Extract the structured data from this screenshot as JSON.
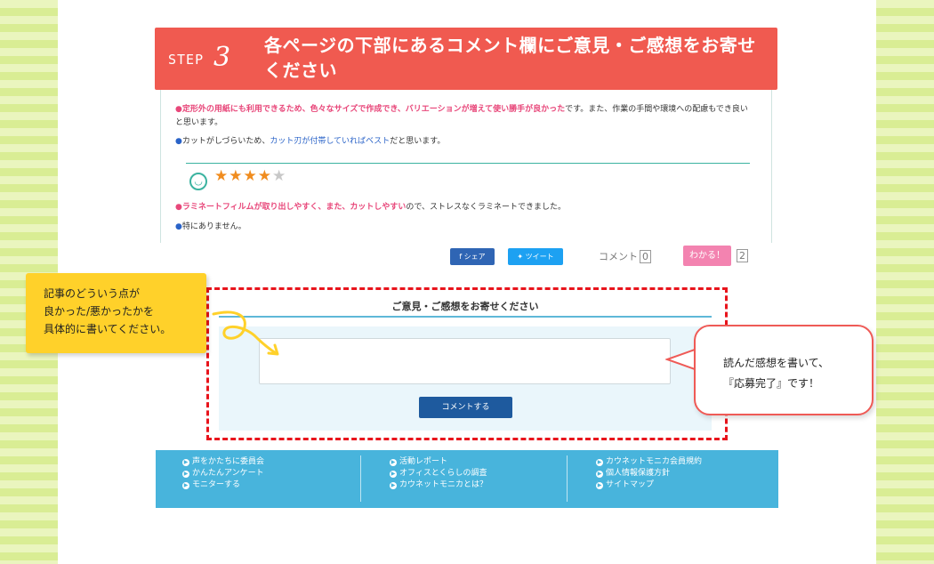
{
  "header": {
    "step_word": "STEP",
    "step_number": "3",
    "title": "各ページの下部にあるコメント欄にご意見・ご感想をお寄せください"
  },
  "review": {
    "p1_highlight": "定形外の用紙にも利用できるため、色々なサイズで作成でき、バリエーションが増えて使い勝手が良かった",
    "p1_rest": "です。また、作業の手間や環境への配慮もでき良いと思います。",
    "p2_before": "カットがしづらいため、",
    "p2_link": "カット刃が付帯していればベスト",
    "p2_after": "だと思います。",
    "rating_filled": "★★★★",
    "rating_empty": "★",
    "p3_highlight": "ラミネートフィルムが取り出しやすく、また、カットしやすい",
    "p3_rest": "ので、ストレスなくラミネートできました。",
    "p4": "特にありません。"
  },
  "share": {
    "facebook_label": "シェア",
    "twitter_label": "ツイート",
    "comment_label": "コメント",
    "comment_count": "0",
    "like_label": "わかる！",
    "like_count": "2"
  },
  "form": {
    "title": "ご意見・ご感想をお寄せください",
    "textarea_value": "",
    "submit_label": "コメントする"
  },
  "annotations": {
    "yellow_note": [
      "記事のどういう点が",
      "良かった/悪かったかを",
      "具体的に書いてください。"
    ],
    "bubble": [
      "読んだ感想を書いて、",
      "『応募完了』です！"
    ]
  },
  "footer": {
    "col1": [
      "声をかたちに委員会",
      "かんたんアンケート",
      "モニターする"
    ],
    "col2": [
      "活動レポート",
      "オフィスとくらしの調査",
      "カウネットモニカとは？"
    ],
    "col3": [
      "カウネットモニカ会員規約",
      "個人情報保護方針",
      "サイトマップ"
    ]
  },
  "colors": {
    "banner": "#f05a50",
    "accent_pink": "#e8477a",
    "accent_blue": "#2a63c8",
    "footer": "#48b4dc",
    "note_yellow": "#ffd12a",
    "dashed_red": "#e8141c"
  }
}
